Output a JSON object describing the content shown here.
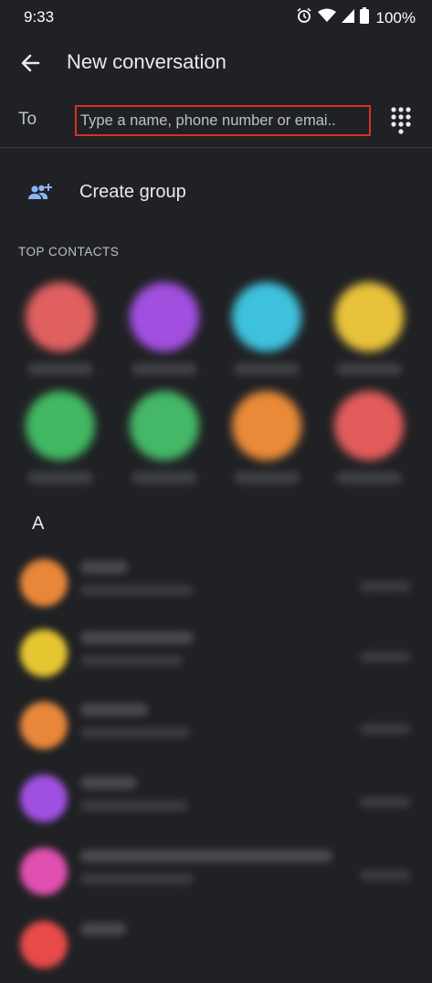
{
  "status": {
    "time": "9:33",
    "battery": "100%"
  },
  "header": {
    "title": "New conversation"
  },
  "to": {
    "label": "To",
    "placeholder": "Type a name, phone number or emai..",
    "value": ""
  },
  "create_group": {
    "label": "Create group"
  },
  "top_contacts": {
    "label": "TOP CONTACTS",
    "contacts": [
      {
        "color": "#e06060"
      },
      {
        "color": "#a24fe0"
      },
      {
        "color": "#3ec1dc"
      },
      {
        "color": "#e8c23a"
      },
      {
        "color": "#42b862"
      },
      {
        "color": "#44b866"
      },
      {
        "color": "#ea8a38"
      },
      {
        "color": "#e25c5c"
      }
    ]
  },
  "list": {
    "section_letter": "A",
    "rows": [
      {
        "color": "#e8873a"
      },
      {
        "color": "#e6c630"
      },
      {
        "color": "#e8873a"
      },
      {
        "color": "#a050e0"
      },
      {
        "color": "#e050b0"
      },
      {
        "color": "#e84a4a"
      }
    ]
  },
  "colors": {
    "background": "#202124",
    "highlight_border": "#d93025",
    "accent": "#8ab4f8"
  }
}
